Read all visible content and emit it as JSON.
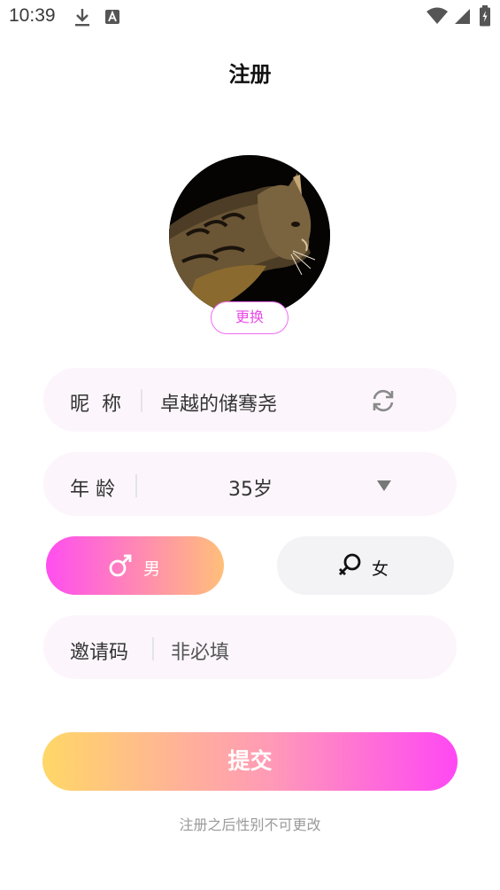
{
  "status_bar": {
    "time": "10:39"
  },
  "header": {
    "title": "注册"
  },
  "avatar": {
    "change_label": "更换"
  },
  "nickname": {
    "label": "昵  称",
    "value": "卓越的储骞尧"
  },
  "age": {
    "label": "年 龄",
    "value": "35岁"
  },
  "gender": {
    "male_label": "男",
    "female_label": "女"
  },
  "invite_code": {
    "label": "邀请码",
    "placeholder": "非必填"
  },
  "submit": {
    "label": "提交"
  },
  "note": "注册之后性别不可更改",
  "colors": {
    "accent_pink": "#ff4ef0",
    "accent_orange": "#ffbf7a",
    "submit_start": "#ffd767",
    "submit_end": "#ff48f4",
    "field_bg": "#fcf6fc"
  }
}
